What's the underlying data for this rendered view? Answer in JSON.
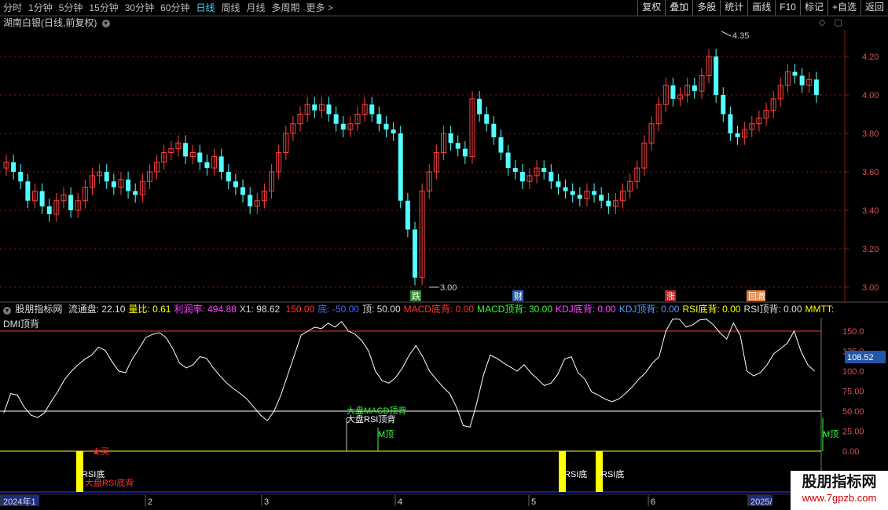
{
  "toolbar": {
    "periods": [
      "分时",
      "1分钟",
      "5分钟",
      "15分钟",
      "30分钟",
      "60分钟",
      "日线",
      "周线",
      "月线",
      "多周期",
      "更多 >"
    ],
    "active_period": "日线",
    "right_buttons": [
      "复权",
      "叠加",
      "多股",
      "统计",
      "画线",
      "F10",
      "标记",
      "+自选",
      "返回"
    ]
  },
  "stock": {
    "name": "湖南白银",
    "subtitle": "(日线,前复权)",
    "high_label": "4.35",
    "low_label": "3.00"
  },
  "price_axis": {
    "ticks": [
      "4.20",
      "4.00",
      "3.80",
      "3.60",
      "3.40",
      "3.20",
      "3.00"
    ],
    "values": [
      4.2,
      4.0,
      3.8,
      3.6,
      3.4,
      3.2,
      3.0
    ]
  },
  "events": [
    {
      "label": "跌",
      "color": "#2e8b2e"
    },
    {
      "label": "财",
      "color": "#2d5da8"
    },
    {
      "label": "涨",
      "color": "#b22222"
    },
    {
      "label": "回澈",
      "color": "#e07a3a"
    }
  ],
  "indicator": {
    "name": "股朋指标网",
    "fields": [
      {
        "label": "流通盘:",
        "value": "22.10",
        "color": "#dddddd"
      },
      {
        "label": "量比:",
        "value": "0.61",
        "color": "#ffff00"
      },
      {
        "label": "利润率:",
        "value": "494.88",
        "color": "#ff44ff"
      },
      {
        "label": "X1:",
        "value": "98.62",
        "color": "#dddddd"
      },
      {
        "label": "",
        "value": "150.00",
        "color": "#ff3333"
      },
      {
        "label": "底:",
        "value": "-50.00",
        "color": "#4466ff"
      },
      {
        "label": "顶:",
        "value": "50.00",
        "color": "#dddddd"
      },
      {
        "label": "MACD底背:",
        "value": "0.00",
        "color": "#ff3333"
      },
      {
        "label": "MACD顶背:",
        "value": "30.00",
        "color": "#33ff33"
      },
      {
        "label": "KDJ底背:",
        "value": "0.00",
        "color": "#ff44ff"
      },
      {
        "label": "KDJ顶背:",
        "value": "0.00",
        "color": "#5599ff"
      },
      {
        "label": "RSI底背:",
        "value": "0.00",
        "color": "#ffff00"
      },
      {
        "label": "RSI顶背:",
        "value": "0.00",
        "color": "#dddddd"
      },
      {
        "label": "MMTT:",
        "value": "",
        "color": "#ffff00"
      }
    ],
    "second_line": "DMI顶背",
    "axis_ticks": [
      "150.0",
      "125.0",
      "100.0",
      "75.00",
      "50.00",
      "25.00",
      "0.00"
    ],
    "axis_values": [
      150,
      125,
      100,
      75,
      50,
      25,
      0
    ],
    "current_value": "108.52",
    "signals": {
      "buy": "★买",
      "rsi_bottom": "RSI底",
      "market_rsi_bottom": "大盘RSI底背",
      "market_macd_top": "大盘MACD顶背",
      "market_rsi_top": "大盘RSI顶背",
      "m_top": "M顶"
    }
  },
  "date_axis": {
    "labels": [
      "2024年1",
      "2",
      "3",
      "4",
      "5",
      "6",
      "2025/"
    ]
  },
  "colors": {
    "up": "#ff4040",
    "down": "#54ffff",
    "grid": "#8b1a1a",
    "axis_text": "#e05050"
  },
  "watermark": {
    "line1": "股朋指标网",
    "line2": "www.7gpzb.com"
  }
}
